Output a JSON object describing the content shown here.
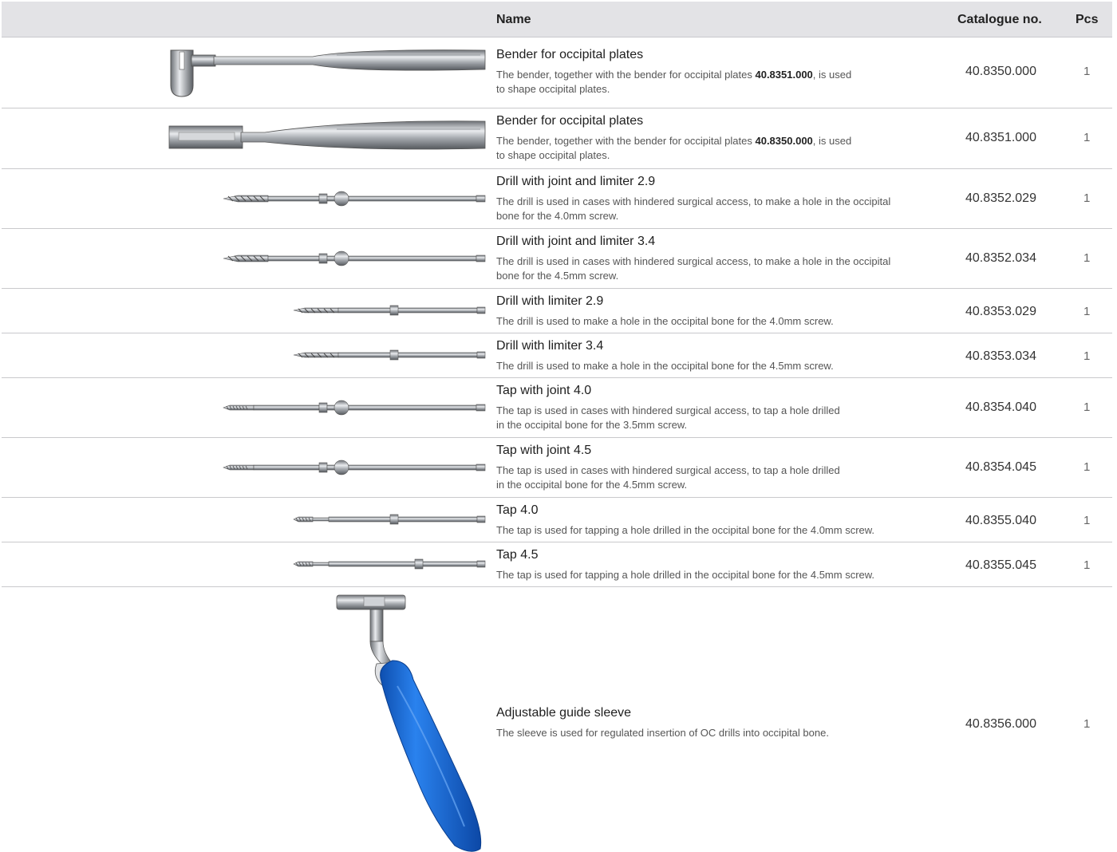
{
  "table": {
    "headers": {
      "name": "Name",
      "catalogue": "Catalogue no.",
      "pcs": "Pcs"
    },
    "rows": [
      {
        "title": "Bender for occipital plates",
        "desc_pre": "The bender, together with the bender for occipital plates ",
        "desc_ref": "40.8351.000",
        "desc_mid": ", is used",
        "desc_post": "to shape occipital plates.",
        "catalogue": "40.8350.000",
        "pcs": "1",
        "image": "occipital-plate-bender-slotted-tip"
      },
      {
        "title": "Bender for occipital plates",
        "desc_pre": "The bender, together with the bender for occipital plates ",
        "desc_ref": "40.8350.000",
        "desc_mid": ", is used",
        "desc_post": "to shape occipital plates.",
        "catalogue": "40.8351.000",
        "pcs": "1",
        "image": "occipital-plate-bender-flat-tip"
      },
      {
        "title": "Drill with joint and limiter 2.9",
        "desc": "The drill is used in cases with hindered surgical access, to make a hole in the occipital",
        "desc2": "bone for the 4.0mm screw.",
        "catalogue": "40.8352.029",
        "pcs": "1",
        "image": "drill-with-joint"
      },
      {
        "title": "Drill with joint and limiter 3.4",
        "desc": "The drill is used in cases with hindered surgical access, to make a hole in the occipital",
        "desc2": "bone for the 4.5mm screw.",
        "catalogue": "40.8352.034",
        "pcs": "1",
        "image": "drill-with-joint"
      },
      {
        "title": "Drill with limiter 2.9",
        "desc": "The drill is used to make a hole in the occipital bone for the 4.0mm screw.",
        "catalogue": "40.8353.029",
        "pcs": "1",
        "image": "drill-with-limiter"
      },
      {
        "title": "Drill with limiter 3.4",
        "desc": "The drill is used to make a hole in the occipital bone for the 4.5mm screw.",
        "catalogue": "40.8353.034",
        "pcs": "1",
        "image": "drill-with-limiter"
      },
      {
        "title": "Tap with joint 4.0",
        "desc": "The tap is used in cases with hindered surgical access, to tap a hole drilled",
        "desc2": "in the occipital bone for the 3.5mm screw.",
        "catalogue": "40.8354.040",
        "pcs": "1",
        "image": "tap-with-joint"
      },
      {
        "title": "Tap with joint 4.5",
        "desc": "The tap is used in cases with hindered surgical access, to tap a hole drilled",
        "desc2": "in the occipital bone for the 4.5mm screw.",
        "catalogue": "40.8354.045",
        "pcs": "1",
        "image": "tap-with-joint"
      },
      {
        "title": "Tap 4.0",
        "desc": "The tap is used for tapping a hole drilled in the occipital bone for the 4.0mm screw.",
        "catalogue": "40.8355.040",
        "pcs": "1",
        "image": "tap"
      },
      {
        "title": "Tap 4.5",
        "desc": "The tap is used for tapping a hole drilled in the occipital bone for the 4.5mm screw.",
        "catalogue": "40.8355.045",
        "pcs": "1",
        "image": "tap"
      },
      {
        "title": "Adjustable guide sleeve",
        "desc": "The sleeve is used for regulated insertion of OC drills into occipital bone.",
        "catalogue": "40.8356.000",
        "pcs": "1",
        "image": "guide-sleeve-blue-handle"
      }
    ]
  },
  "colors": {
    "header_bg": "#e3e3e6",
    "rule": "#c9c9cc",
    "steel": "#9a9ea3",
    "handle_blue": "#1f6fd6"
  }
}
